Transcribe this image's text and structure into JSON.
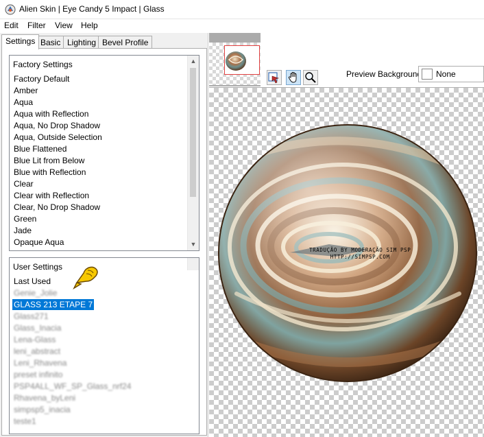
{
  "window": {
    "title": "Alien Skin | Eye Candy 5 Impact | Glass"
  },
  "menu": [
    "Edit",
    "Filter",
    "View",
    "Help"
  ],
  "tabs": [
    "Settings",
    "Basic",
    "Lighting",
    "Bevel Profile"
  ],
  "factory_settings": {
    "header": "Factory Settings",
    "items": [
      "Factory Default",
      "Amber",
      "Aqua",
      "Aqua with Reflection",
      "Aqua, No Drop Shadow",
      "Aqua, Outside Selection",
      "Blue Flattened",
      "Blue Lit from Below",
      "Blue with Reflection",
      "Clear",
      "Clear with Reflection",
      "Clear, No Drop Shadow",
      "Green",
      "Jade",
      "Opaque Aqua"
    ]
  },
  "user_settings": {
    "header": "User Settings",
    "last_used": "Last Used",
    "selected": "GLASS 213 ETAPE 7",
    "blurred_items": [
      "Genie_Jolie",
      "Glass271",
      "Glass_Inacia",
      "Lena-Glass",
      "leni_abstract",
      "Leni_Rhavena",
      "preset infinito",
      "PSP4ALL_WF_SP_Glass_nrf24",
      "Rhavena_byLeni",
      "simpsp5_inacia",
      "teste1"
    ]
  },
  "preview": {
    "background_label": "Preview Background:",
    "background_value": "None"
  },
  "watermark": {
    "line1": "TRADUÇÃO BY MODERAÇÃO SIM PSP",
    "line2": "HTTP://SIMPSP.COM"
  },
  "icons": {
    "app": "eye-candy-app-icon",
    "navigate": "navigate-icon",
    "hand": "hand-icon",
    "zoom": "magnifier-icon",
    "pointer": "pointing-hand-icon"
  }
}
